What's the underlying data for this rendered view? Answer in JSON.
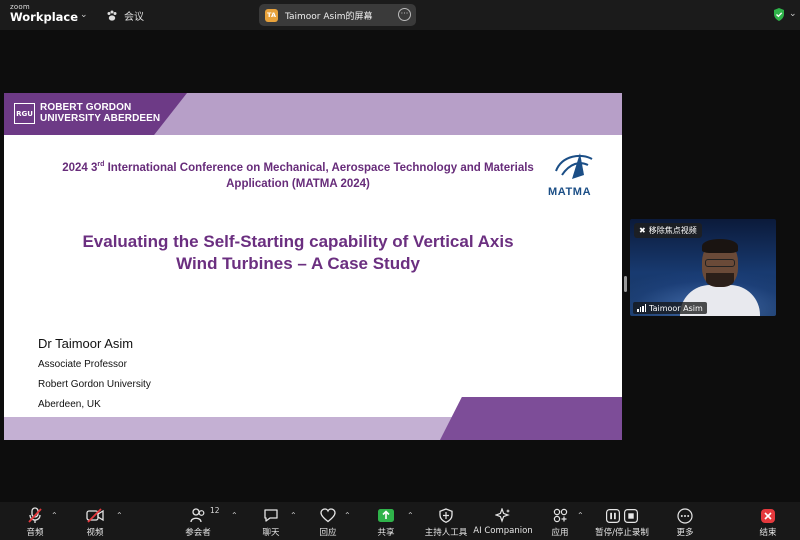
{
  "app": {
    "brand_small": "zoom",
    "brand_large": "Workplace"
  },
  "topbar": {
    "meeting_label": "会议",
    "share_title": "Taimoor Asim的屏幕",
    "share_badge": "TA"
  },
  "slide": {
    "university": [
      "ROBERT GORDON",
      "UNIVERSITY ABERDEEN"
    ],
    "university_mark": "RGU",
    "conference_prefix": "2024 3",
    "conference_sup": "rd",
    "conference_rest": " International Conference on Mechanical, Aerospace Technology and Materials",
    "conference_line2": "Application (MATMA 2024)",
    "conference_logo": "MATMA",
    "title_line1": "Evaluating the Self-Starting capability of Vertical Axis",
    "title_line2": "Wind Turbines – A Case Study",
    "presenter_name": "Dr Taimoor Asim",
    "presenter_role": "Associate Professor",
    "presenter_org": "Robert Gordon University",
    "presenter_location": "Aberdeen, UK"
  },
  "video": {
    "unpin_label": "移除焦点视频",
    "participant_name": "Taimoor Asim"
  },
  "toolbar": {
    "audio": "音频",
    "video": "视频",
    "participants": "参会者",
    "participants_count": "12",
    "chat": "聊天",
    "react": "回应",
    "share": "共享",
    "host_tools": "主持人工具",
    "ai_companion": "AI Companion",
    "apps": "应用",
    "record": "暂停/停止录制",
    "more": "更多",
    "end": "结束"
  },
  "colors": {
    "accent_purple": "#6b2f80",
    "share_green": "#2fb34a",
    "end_red": "#e5393d",
    "mute_red": "#e5393d"
  }
}
